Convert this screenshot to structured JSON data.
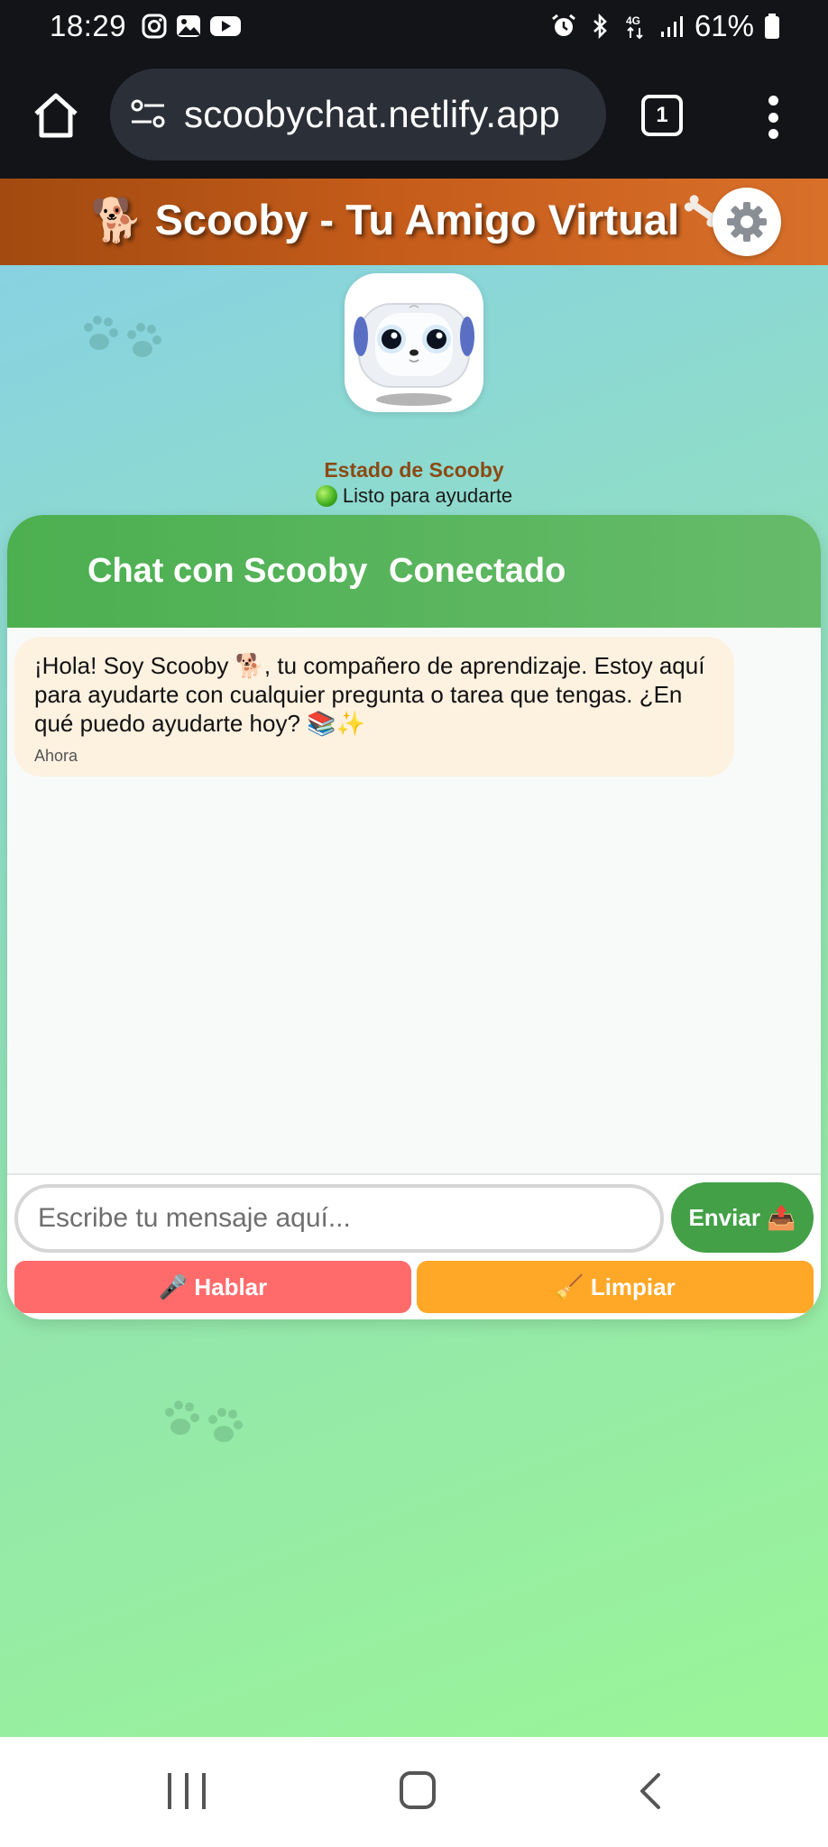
{
  "status_bar": {
    "time": "18:29",
    "battery": "61%",
    "left_icons": [
      "instagram-icon",
      "gallery-icon",
      "youtube-icon"
    ],
    "right_icons": [
      "alarm-icon",
      "bluetooth-icon",
      "4g-icon",
      "signal-icon",
      "battery-icon"
    ]
  },
  "browser": {
    "url": "scoobychat.netlify.app",
    "tab_count": "1"
  },
  "app": {
    "title": "🐕 Scooby - Tu Amigo Virtual",
    "status_title": "Estado de Scooby",
    "status_text": "Listo para ayudarte",
    "colors": {
      "header": "#c75d1b",
      "chat_header": "#4caf50",
      "send": "#43a047",
      "speak": "#ff6b6b",
      "clear": "#ffa726"
    }
  },
  "chat": {
    "title": "Chat con Scooby",
    "connection": "Conectado",
    "messages": [
      {
        "text": "¡Hola! Soy Scooby 🐕, tu compañero de aprendizaje. Estoy aquí para ayudarte con cualquier pregunta o tarea que tengas. ¿En qué puedo ayudarte hoy? 📚✨",
        "time": "Ahora"
      }
    ],
    "input_placeholder": "Escribe tu mensaje aquí...",
    "send_label": "Enviar 📤",
    "speak_label": "🎤 Hablar",
    "clear_label": "🧹 Limpiar"
  }
}
